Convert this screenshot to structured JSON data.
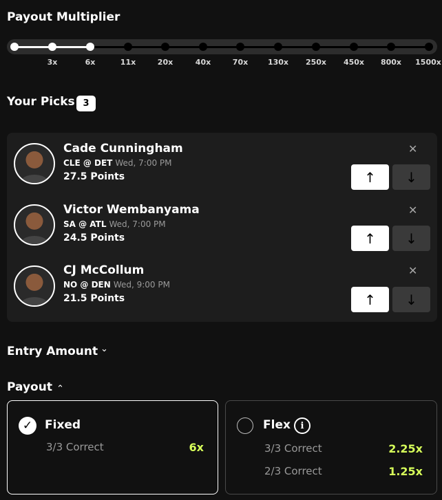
{
  "multiplier": {
    "title": "Payout Multiplier",
    "ticks": [
      "3x",
      "6x",
      "11x",
      "20x",
      "40x",
      "70x",
      "130x",
      "250x",
      "450x",
      "800x",
      "1500x"
    ],
    "selected_stops": 3
  },
  "picks": {
    "title": "Your Picks",
    "count": "3",
    "items": [
      {
        "name": "Cade Cunningham",
        "teams": "CLE @ DET",
        "time": "Wed, 7:00 PM",
        "line": "27.5 Points"
      },
      {
        "name": "Victor Wembanyama",
        "teams": "SA @ ATL",
        "time": "Wed, 7:00 PM",
        "line": "24.5 Points"
      },
      {
        "name": "CJ McCollum",
        "teams": "NO @ DEN",
        "time": "Wed, 9:00 PM",
        "line": "21.5 Points"
      }
    ],
    "close_glyph": "✕",
    "up_glyph": "↑",
    "down_glyph": "↓"
  },
  "entry": {
    "title": "Entry Amount",
    "chevron": "⌄"
  },
  "payout": {
    "title": "Payout",
    "chevron": "⌃",
    "fixed": {
      "label": "Fixed",
      "check": "✓",
      "rows": [
        {
          "label": "3/3 Correct",
          "value": "6x"
        }
      ]
    },
    "flex": {
      "label": "Flex",
      "info": "i",
      "rows": [
        {
          "label": "3/3 Correct",
          "value": "2.25x"
        },
        {
          "label": "2/3 Correct",
          "value": "1.25x"
        }
      ]
    }
  },
  "colors": {
    "accent": "#d7ff5a",
    "bg": "#111111",
    "panel": "#1d1d1d"
  }
}
